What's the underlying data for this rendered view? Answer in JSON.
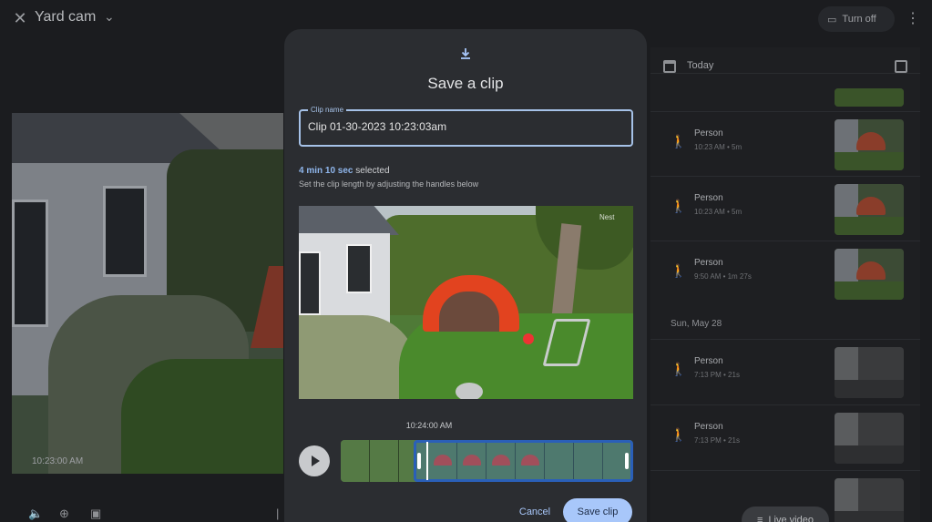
{
  "header": {
    "title": "Yard cam",
    "turn_off_label": "Turn off"
  },
  "feed": {
    "timestamp": "10:23:00 AM"
  },
  "sidebar": {
    "day": "Today",
    "second_day": "Sun, May 28",
    "events": [
      {
        "title": "Person",
        "meta": "10:23 AM • 5m"
      },
      {
        "title": "Person",
        "meta": "10:23 AM • 5m"
      },
      {
        "title": "Person",
        "meta": "9:50 AM • 1m 27s"
      },
      {
        "title": "Person",
        "meta": "7:13 PM • 21s"
      },
      {
        "title": "Person",
        "meta": "7:13 PM • 21s"
      }
    ],
    "live_video_label": "Live video"
  },
  "modal": {
    "title": "Save a clip",
    "field_label": "Clip name",
    "clip_name": "Clip 01-30-2023 10:23:03am",
    "selected_duration": "4 min 10 sec",
    "selected_suffix": "selected",
    "hint": "Set the clip length by adjusting the handles below",
    "preview_watermark": "Nest",
    "time_label": "10:24:00 AM",
    "cancel_label": "Cancel",
    "save_label": "Save clip"
  },
  "colors": {
    "accent": "#a8c7fa",
    "selection": "#2a5fb8",
    "tent": "#e2431f"
  }
}
